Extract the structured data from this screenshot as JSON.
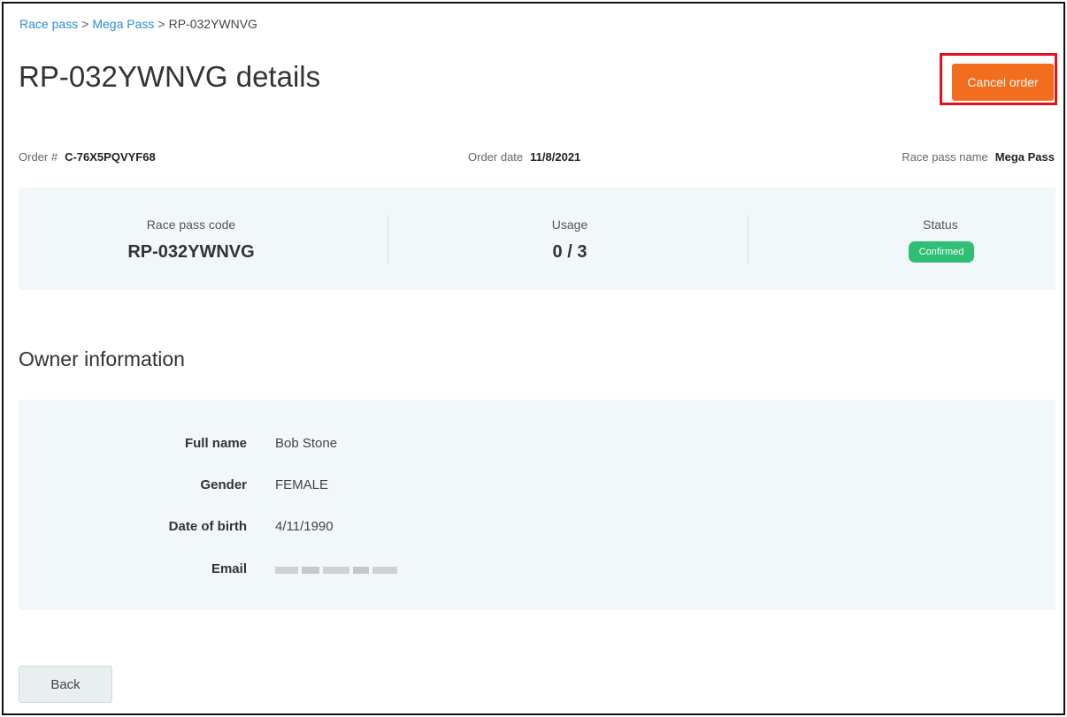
{
  "breadcrumb": {
    "items": [
      "Race pass",
      "Mega Pass",
      "RP-032YWNVG"
    ],
    "separator": ">"
  },
  "page": {
    "title": "RP-032YWNVG details",
    "cancel_label": "Cancel order",
    "accent_color": "#f26d1d",
    "highlight_color": "#e3111b"
  },
  "meta": {
    "order_label": "Order #",
    "order_value": "C-76X5PQVYF68",
    "date_label": "Order date",
    "date_value": "11/8/2021",
    "pass_name_label": "Race pass name",
    "pass_name_value": "Mega Pass"
  },
  "summary": {
    "code_label": "Race pass code",
    "code_value": "RP-032YWNVG",
    "usage_label": "Usage",
    "usage_value": "0 / 3",
    "status_label": "Status",
    "status_value": "Confirmed",
    "status_color": "#2ebf74"
  },
  "owner": {
    "section_title": "Owner information",
    "full_name_label": "Full name",
    "full_name_value": "Bob Stone",
    "gender_label": "Gender",
    "gender_value": "FEMALE",
    "dob_label": "Date of birth",
    "dob_value": "4/11/1990",
    "email_label": "Email"
  },
  "footer": {
    "back_label": "Back"
  }
}
